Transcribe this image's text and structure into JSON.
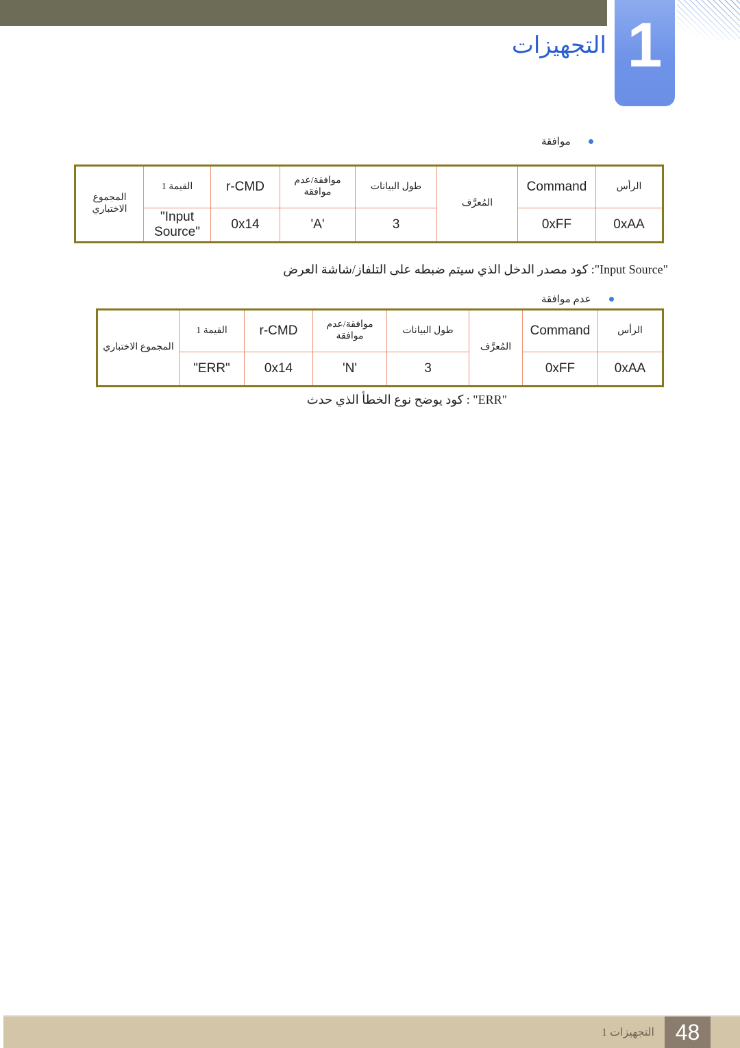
{
  "header": {
    "chapter_number": "1",
    "title": "التجهيزات",
    "bar_color": "#6d6c57",
    "tab_color": "#6f93e8",
    "title_color": "#2a5fd0"
  },
  "content": {
    "bullet_ack": "موافقة",
    "bullet_nak": "عدم موافقة",
    "note_input_source": "\"Input Source\": كود مصدر الدخل الذي سيتم ضبطه على التلفاز/شاشة العرض",
    "note_err": "\"ERR\" : كود يوضح نوع الخطأ الذي حدث"
  },
  "tables": {
    "ack": {
      "headers": [
        "الرأس",
        "Command",
        "المُعرَّف",
        "طول البيانات",
        "موافقة/عدم موافقة",
        "r-CMD",
        "القيمة 1",
        "المجموع الاختباري"
      ],
      "values": [
        "0xAA",
        "0xFF",
        "",
        "3",
        "'A'",
        "0x14",
        "\"Input Source\"",
        ""
      ]
    },
    "nak": {
      "headers": [
        "الرأس",
        "Command",
        "المُعرَّف",
        "طول البيانات",
        "موافقة/عدم موافقة",
        "r-CMD",
        "القيمة 1",
        "المجموع الاختباري"
      ],
      "values": [
        "0xAA",
        "0xFF",
        "",
        "3",
        "'N'",
        "0x14",
        "\"ERR\"",
        ""
      ]
    }
  },
  "footer": {
    "label": "التجهيزات 1",
    "page_number": "48",
    "bar_color": "#d3c6a8",
    "page_box_color": "#8a7d6d"
  },
  "table_colors": {
    "outer_border": "#87791f",
    "inner_border": "#eb9071"
  }
}
